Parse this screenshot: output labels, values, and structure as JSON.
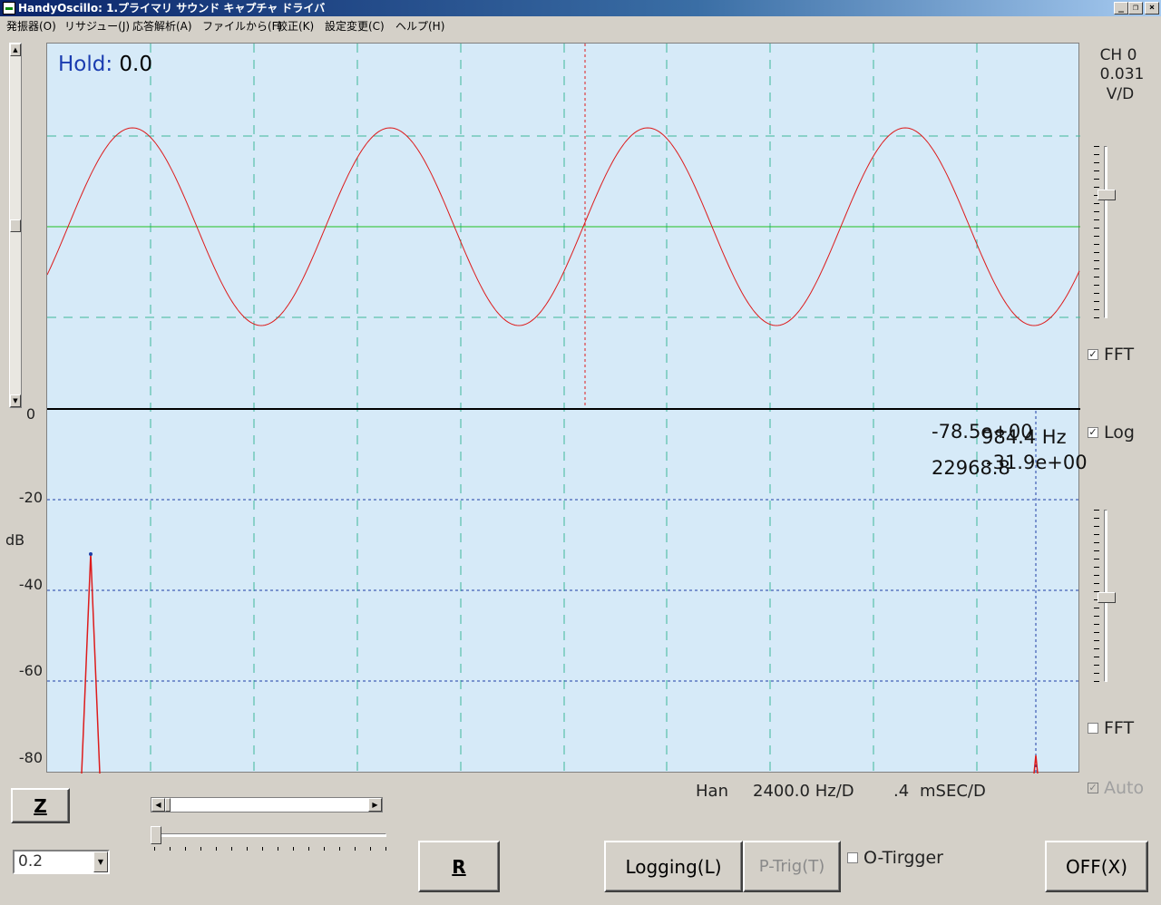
{
  "window": {
    "title": "HandyOscillo:  1.プライマリ サウンド キャプチャ ドライバ",
    "controls": {
      "minimize": "_",
      "restore": "❐",
      "close": "×"
    }
  },
  "menu": [
    {
      "label": "発振器(O)"
    },
    {
      "label": "リサジュー(J)"
    },
    {
      "label": "応答解析(A)"
    },
    {
      "label": "ファイルから(F)"
    },
    {
      "label": "較正(K)"
    },
    {
      "label": "設定変更(C)"
    },
    {
      "label": "ヘルプ(H)"
    }
  ],
  "scope": {
    "hold_label": "Hold:",
    "hold_value": "0.0",
    "cursor_readout": {
      "line1": "-78.5e+00",
      "line2": "984.4 Hz",
      "line3": "-31.9e+00",
      "line4": "22968.8"
    }
  },
  "db_axis": {
    "unit": "dB",
    "labels": [
      "0",
      "-20",
      "-40",
      "-60",
      "-80"
    ]
  },
  "right_panel": {
    "channel": "CH 0",
    "volts": "0.031",
    "unit": "V/D",
    "fft_top": {
      "label": "FFT",
      "checked": true
    },
    "log": {
      "label": "Log",
      "checked": true
    },
    "fft_bottom": {
      "label": "FFT",
      "checked": false
    },
    "auto": {
      "label": "Auto",
      "checked": true,
      "enabled": false
    }
  },
  "status": {
    "window_fn": "Han",
    "freq_div": "2400.0 Hz/D",
    "time_div_value": ".4",
    "time_div_unit": "mSEC/D"
  },
  "controls": {
    "z_button": "Z",
    "r_button": "R",
    "logging_button": "Logging(L)",
    "ptrig_button": "P-Trig(T)",
    "otrigger": {
      "label": "O-Tirgger",
      "checked": false
    },
    "off_button": "OFF(X)",
    "combo_value": "0.2",
    "glyphs": {
      "up": "▲",
      "down": "▼",
      "left": "◀",
      "right": "▶",
      "check": "✓"
    }
  },
  "colors": {
    "scope_bg": "#d6eaf8",
    "waveform": "#dd1c1c",
    "grid": "#3fb89a",
    "fft_grid": "#1f3fa6",
    "center_line": "#22c022",
    "cursor": "#1f3fa6",
    "hold_label": "#1a3cb0"
  }
}
